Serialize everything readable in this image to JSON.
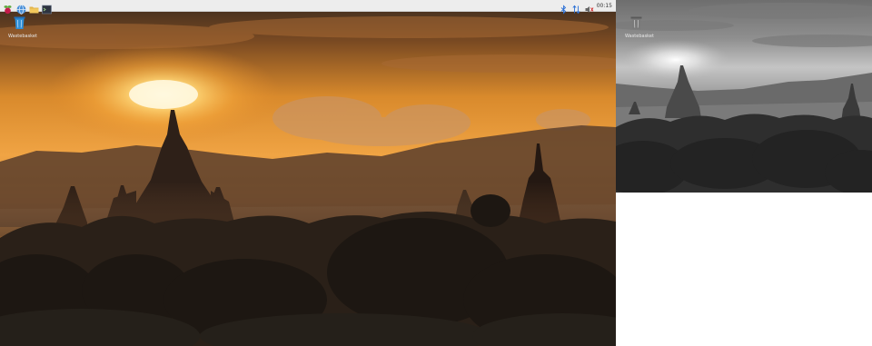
{
  "taskbar": {
    "launchers": [
      {
        "name": "raspberry-menu-icon",
        "label": "Menu"
      },
      {
        "name": "web-browser-icon",
        "label": "Web Browser"
      },
      {
        "name": "file-manager-icon",
        "label": "File Manager"
      },
      {
        "name": "terminal-icon",
        "label": "Terminal"
      }
    ],
    "tray": {
      "icons": [
        "bluetooth-icon",
        "network-arrows-icon",
        "volume-icon"
      ],
      "clock": "00:15"
    }
  },
  "desktop": {
    "primary": {
      "trash_label": "Wastebasket"
    },
    "secondary": {
      "trash_label": "Wastebasket"
    }
  },
  "colors": {
    "taskbar_bg": "#ededed",
    "trash_blue": "#2f8fd6",
    "sky_gold": "#f2a53a",
    "sun_core": "#fff2c4"
  }
}
